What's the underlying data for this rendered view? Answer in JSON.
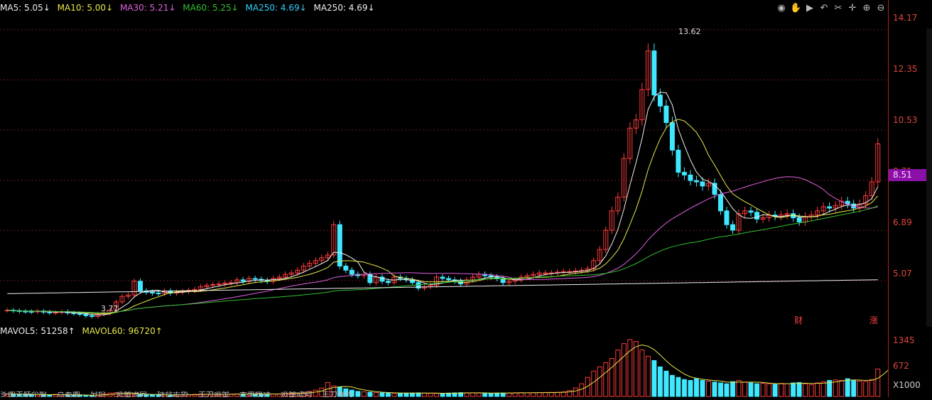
{
  "legend": {
    "ma5": "MA5: 5.05↓",
    "ma10": "MA10: 5.00↓",
    "ma30": "MA30: 5.21↓",
    "ma60": "MA60: 5.25↓",
    "ma250": "MA250: 4.69↓",
    "ma250b": "MA250: 4.69↓"
  },
  "vol_legend": {
    "mavol5": "MAVOL5: 51258↑",
    "mavol60": "MAVOL60: 96720↑"
  },
  "colors": {
    "up": "#ff3b3b",
    "down": "#3ee8ff",
    "ma5": "#f0f0f0",
    "ma10": "#e8e84a",
    "ma30": "#e060e0",
    "ma60": "#30c030",
    "ma250": "#f0f0f0",
    "axis": "#e0463c"
  },
  "toolbar_icons": [
    "eye-icon",
    "hand-icon",
    "play-icon",
    "back-icon",
    "scissors-icon",
    "crosshair-icon",
    "zoom-in-icon",
    "zoom-out-icon"
  ],
  "price_axis": [
    "14.17",
    "12.35",
    "10.53",
    "8.71",
    "6.89",
    "5.07"
  ],
  "current_price": "8.51",
  "volume_axis": [
    "1345",
    "672",
    "X1000"
  ],
  "annotations": {
    "high": "13.62",
    "low": "3.77",
    "cai": "财",
    "zhang": "涨"
  },
  "tabs": [
    "多图关联个股",
    "点差图",
    "分价",
    "资金流向",
    "持仓走势",
    "主力资金",
    "大单统计",
    "资金动向",
    "主力筹码"
  ],
  "chart_data": {
    "type": "candlestick",
    "y_axis": [
      5.07,
      6.89,
      8.71,
      10.53,
      12.35,
      14.17
    ],
    "ylim": [
      3.5,
      14.6
    ],
    "high": 13.62,
    "low": 3.77,
    "last": 8.51,
    "closes": [
      4.0,
      3.98,
      3.96,
      3.95,
      3.94,
      3.97,
      3.93,
      3.91,
      3.92,
      3.95,
      3.9,
      3.88,
      3.85,
      3.8,
      3.77,
      3.85,
      3.9,
      4.0,
      4.3,
      4.5,
      4.55,
      5.05,
      4.7,
      4.65,
      4.62,
      4.6,
      4.7,
      4.62,
      4.65,
      4.68,
      4.72,
      4.75,
      4.85,
      4.9,
      4.93,
      4.95,
      4.98,
      5.0,
      5.1,
      5.05,
      5.15,
      5.12,
      5.08,
      5.05,
      5.15,
      5.2,
      5.3,
      5.35,
      5.45,
      5.6,
      5.7,
      5.8,
      5.9,
      6.0,
      7.1,
      5.6,
      5.45,
      5.3,
      5.25,
      5.3,
      5.0,
      5.2,
      5.05,
      5.0,
      5.2,
      5.15,
      5.1,
      5.0,
      4.8,
      4.85,
      4.9,
      5.2,
      5.15,
      5.1,
      5.05,
      4.95,
      5.1,
      5.2,
      5.3,
      5.25,
      5.2,
      5.15,
      5.0,
      5.05,
      5.1,
      5.2,
      5.25,
      5.3,
      5.35,
      5.35,
      5.35,
      5.38,
      5.4,
      5.4,
      5.42,
      5.45,
      5.5,
      5.8,
      6.2,
      6.9,
      7.6,
      8.1,
      9.5,
      10.6,
      10.9,
      12.0,
      13.4,
      11.8,
      11.4,
      10.8,
      9.8,
      9.0,
      8.9,
      8.7,
      8.65,
      8.5,
      8.6,
      8.2,
      7.6,
      7.1,
      6.9,
      7.5,
      7.6,
      7.55,
      7.3,
      7.35,
      7.45,
      7.4,
      7.45,
      7.5,
      7.35,
      7.2,
      7.4,
      7.45,
      7.6,
      7.75,
      7.7,
      7.8,
      7.95,
      7.85,
      7.7,
      7.85,
      8.15,
      8.65,
      10.03
    ],
    "volumes": [
      60,
      55,
      50,
      48,
      45,
      40,
      38,
      35,
      50,
      40,
      35,
      30,
      35,
      30,
      28,
      35,
      60,
      80,
      90,
      70,
      55,
      60,
      45,
      40,
      42,
      38,
      40,
      36,
      38,
      40,
      45,
      50,
      60,
      55,
      50,
      48,
      52,
      55,
      60,
      58,
      62,
      60,
      55,
      50,
      58,
      60,
      70,
      75,
      80,
      90,
      120,
      150,
      200,
      330,
      250,
      220,
      180,
      150,
      120,
      110,
      100,
      90,
      85,
      80,
      75,
      78,
      80,
      82,
      85,
      80,
      75,
      70,
      72,
      80,
      85,
      90,
      88,
      85,
      80,
      78,
      75,
      80,
      82,
      85,
      88,
      90,
      85,
      88,
      92,
      95,
      98,
      100,
      110,
      140,
      200,
      300,
      450,
      600,
      700,
      800,
      900,
      1100,
      1250,
      1345,
      1300,
      1100,
      950,
      850,
      700,
      600,
      500,
      450,
      400,
      380,
      420,
      380,
      360,
      340,
      320,
      300,
      350,
      380,
      340,
      320,
      300,
      310,
      300,
      290,
      310,
      300,
      320,
      330,
      300,
      280,
      320,
      350,
      380,
      390,
      380,
      420,
      380,
      360,
      350,
      400,
      650,
      900,
      1000,
      980
    ]
  }
}
